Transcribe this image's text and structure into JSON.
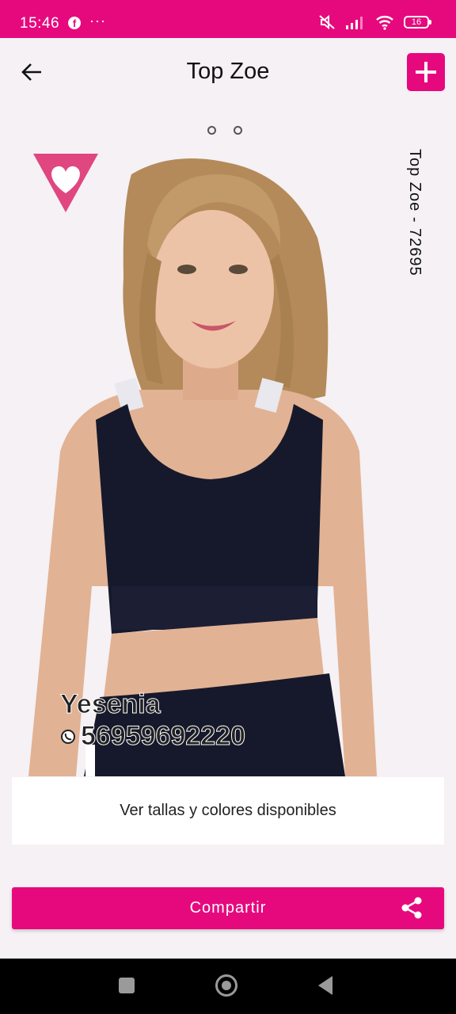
{
  "status_bar": {
    "time": "15:46",
    "overflow": "···",
    "battery": "16"
  },
  "app_bar": {
    "title": "Top Zoe"
  },
  "product": {
    "side_label": "Top Zoe - 72695"
  },
  "seller": {
    "name": "Yesenia",
    "phone": "56959692220"
  },
  "actions": {
    "sizes_label": "Ver tallas y colores disponibles",
    "share_label": "Compartir"
  },
  "colors": {
    "accent": "#e6097e"
  }
}
